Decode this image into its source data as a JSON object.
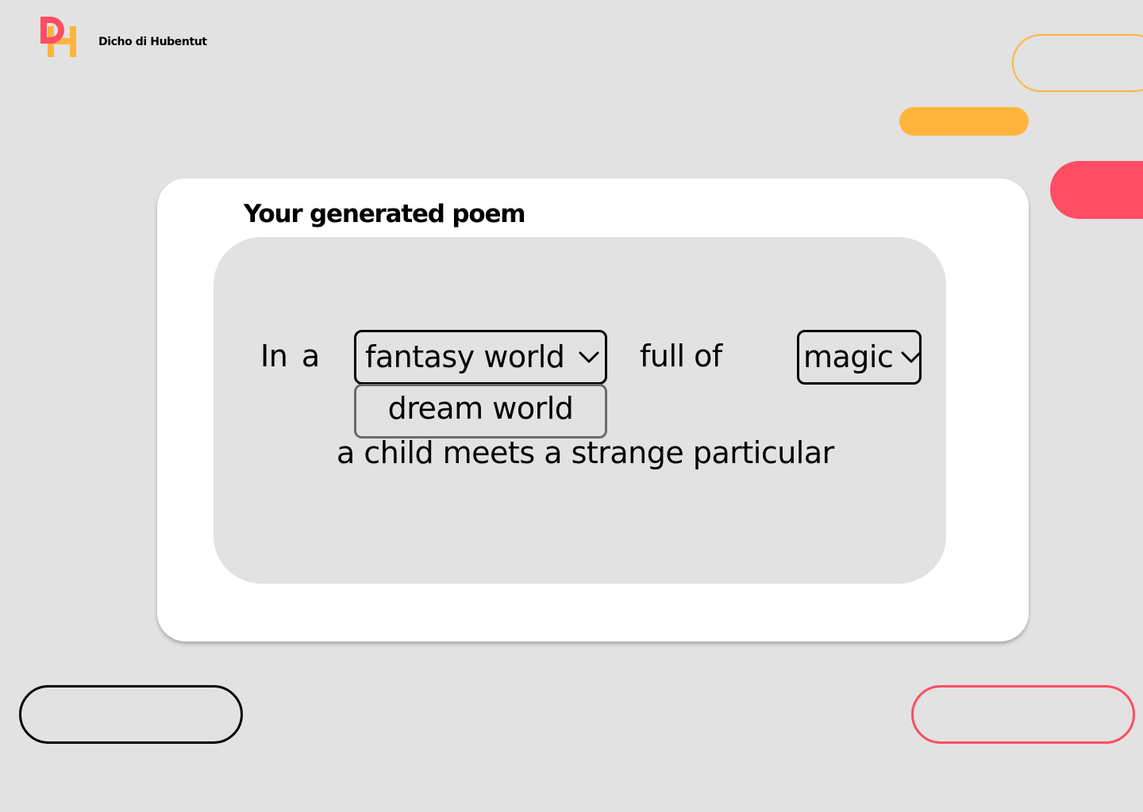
{
  "brand": {
    "name": "Dicho di Hubentut",
    "logo_icon": "dh-monogram-logo",
    "colors": {
      "orange": "#ffb53c",
      "red": "#ff4d63"
    }
  },
  "card": {
    "title": "Your generated poem"
  },
  "poem": {
    "line1_prefix": "In  a",
    "setting_dropdown": {
      "selected": "fantasy world",
      "icon": "chevron-down-icon",
      "open": true,
      "options": [
        "dream world"
      ]
    },
    "line1_middle": "full of",
    "theme_dropdown": {
      "selected": "magic",
      "icon": "chevron-down-icon"
    },
    "line2": "a child meets a strange particular"
  },
  "buttons": {
    "left_label": "",
    "right_label": ""
  }
}
